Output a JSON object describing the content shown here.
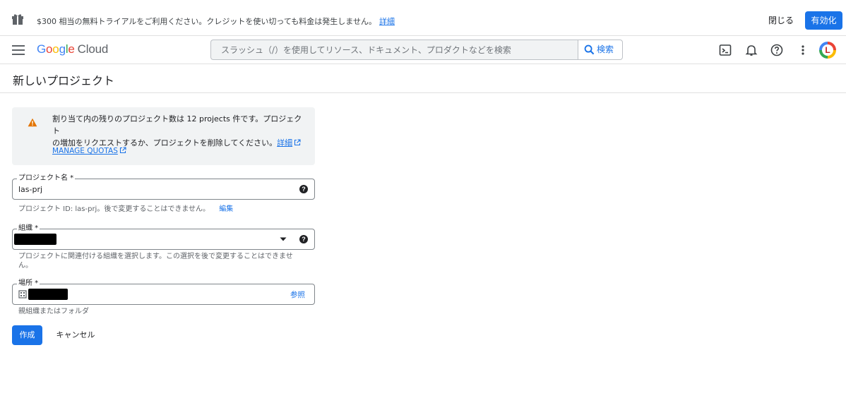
{
  "banner": {
    "message": "$300 相当の無料トライアルをご利用ください。クレジットを使い切っても料金は発生しません。",
    "details_link": "詳細",
    "close_label": "閉じる",
    "activate_label": "有効化"
  },
  "topbar": {
    "logo_google": [
      "G",
      "o",
      "o",
      "g",
      "l",
      "e"
    ],
    "logo_cloud": "Cloud",
    "search_placeholder": "スラッシュ（/）を使用してリソース、ドキュメント、プロダクトなどを検索",
    "search_button": "検索",
    "avatar_letter": "L"
  },
  "page": {
    "title": "新しいプロジェクト"
  },
  "warning": {
    "line1": "割り当て内の残りのプロジェクト数は 12 projects 件です。プロジェクト",
    "line2": "の増加をリクエストするか、プロジェクトを削除してください。",
    "details_link": "詳細",
    "manage_quotas": "MANAGE QUOTAS"
  },
  "form": {
    "project_name": {
      "label": "プロジェクト名 *",
      "value": "las-prj",
      "hint": "プロジェクト ID: las-prj。後で変更することはできません。",
      "edit_link": "編集"
    },
    "organization": {
      "label": "組織 *",
      "hint": "プロジェクトに関連付ける組織を選択します。この選択を後で変更することはできません。"
    },
    "location": {
      "label": "場所 *",
      "browse": "参照",
      "hint": "親組織またはフォルダ"
    },
    "create_label": "作成",
    "cancel_label": "キャンセル"
  },
  "colors": {
    "primary": "#1a73e8",
    "warning": "#e37400",
    "border": "#80868b"
  }
}
